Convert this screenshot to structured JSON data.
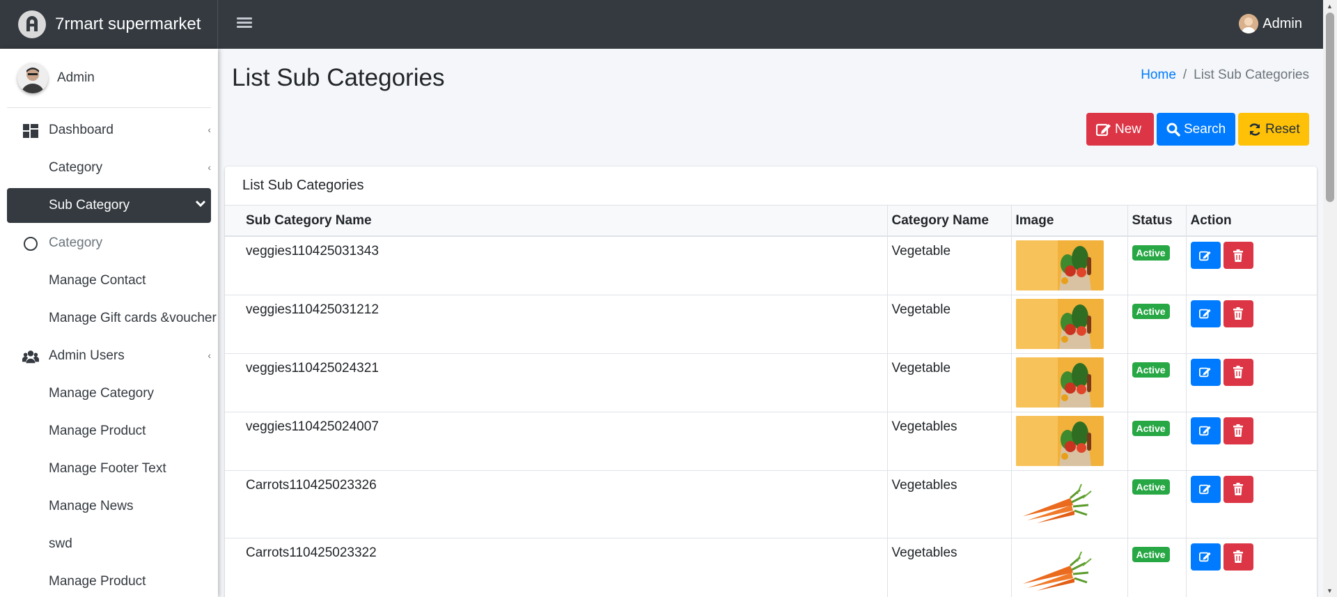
{
  "app": {
    "name": "7rmart supermarket"
  },
  "topbar": {
    "user_name": "Admin"
  },
  "sidebar": {
    "user_name": "Admin",
    "items": [
      {
        "label": "Dashboard",
        "icon": "dashboard-icon"
      },
      {
        "label": "Category"
      },
      {
        "label": "Sub Category"
      },
      {
        "label": "Category",
        "icon": "circle-icon"
      },
      {
        "label": "Manage Contact"
      },
      {
        "label": "Manage Gift cards &voucher"
      },
      {
        "label": "Admin Users",
        "icon": "users-icon"
      },
      {
        "label": "Manage Category"
      },
      {
        "label": "Manage Product"
      },
      {
        "label": "Manage Footer Text"
      },
      {
        "label": "Manage News"
      },
      {
        "label": "swd"
      },
      {
        "label": "Manage Product"
      }
    ]
  },
  "page": {
    "title": "List Sub Categories",
    "breadcrumb": {
      "home": "Home",
      "separator": "/",
      "current": "List Sub Categories"
    }
  },
  "actions": {
    "new": "New",
    "search": "Search",
    "reset": "Reset"
  },
  "card": {
    "title": "List Sub Categories",
    "columns": [
      "Sub Category Name",
      "Category Name",
      "Image",
      "Status",
      "Action"
    ],
    "rows": [
      {
        "name": "veggies110425031343",
        "category": "Vegetable",
        "image": "veggies-bag",
        "status": "Active"
      },
      {
        "name": "veggies110425031212",
        "category": "Vegetable",
        "image": "veggies-bag",
        "status": "Active"
      },
      {
        "name": "veggies110425024321",
        "category": "Vegetable",
        "image": "veggies-bag",
        "status": "Active"
      },
      {
        "name": "veggies110425024007",
        "category": "Vegetables",
        "image": "veggies-bag",
        "status": "Active"
      },
      {
        "name": "Carrots110425023326",
        "category": "Vegetables",
        "image": "carrots",
        "status": "Active"
      },
      {
        "name": "Carrots110425023322",
        "category": "Vegetables",
        "image": "carrots",
        "status": "Active"
      }
    ]
  },
  "colors": {
    "navbar": "#343a40",
    "primary": "#007bff",
    "danger": "#dc3545",
    "warning": "#ffc107",
    "success": "#28a745"
  }
}
